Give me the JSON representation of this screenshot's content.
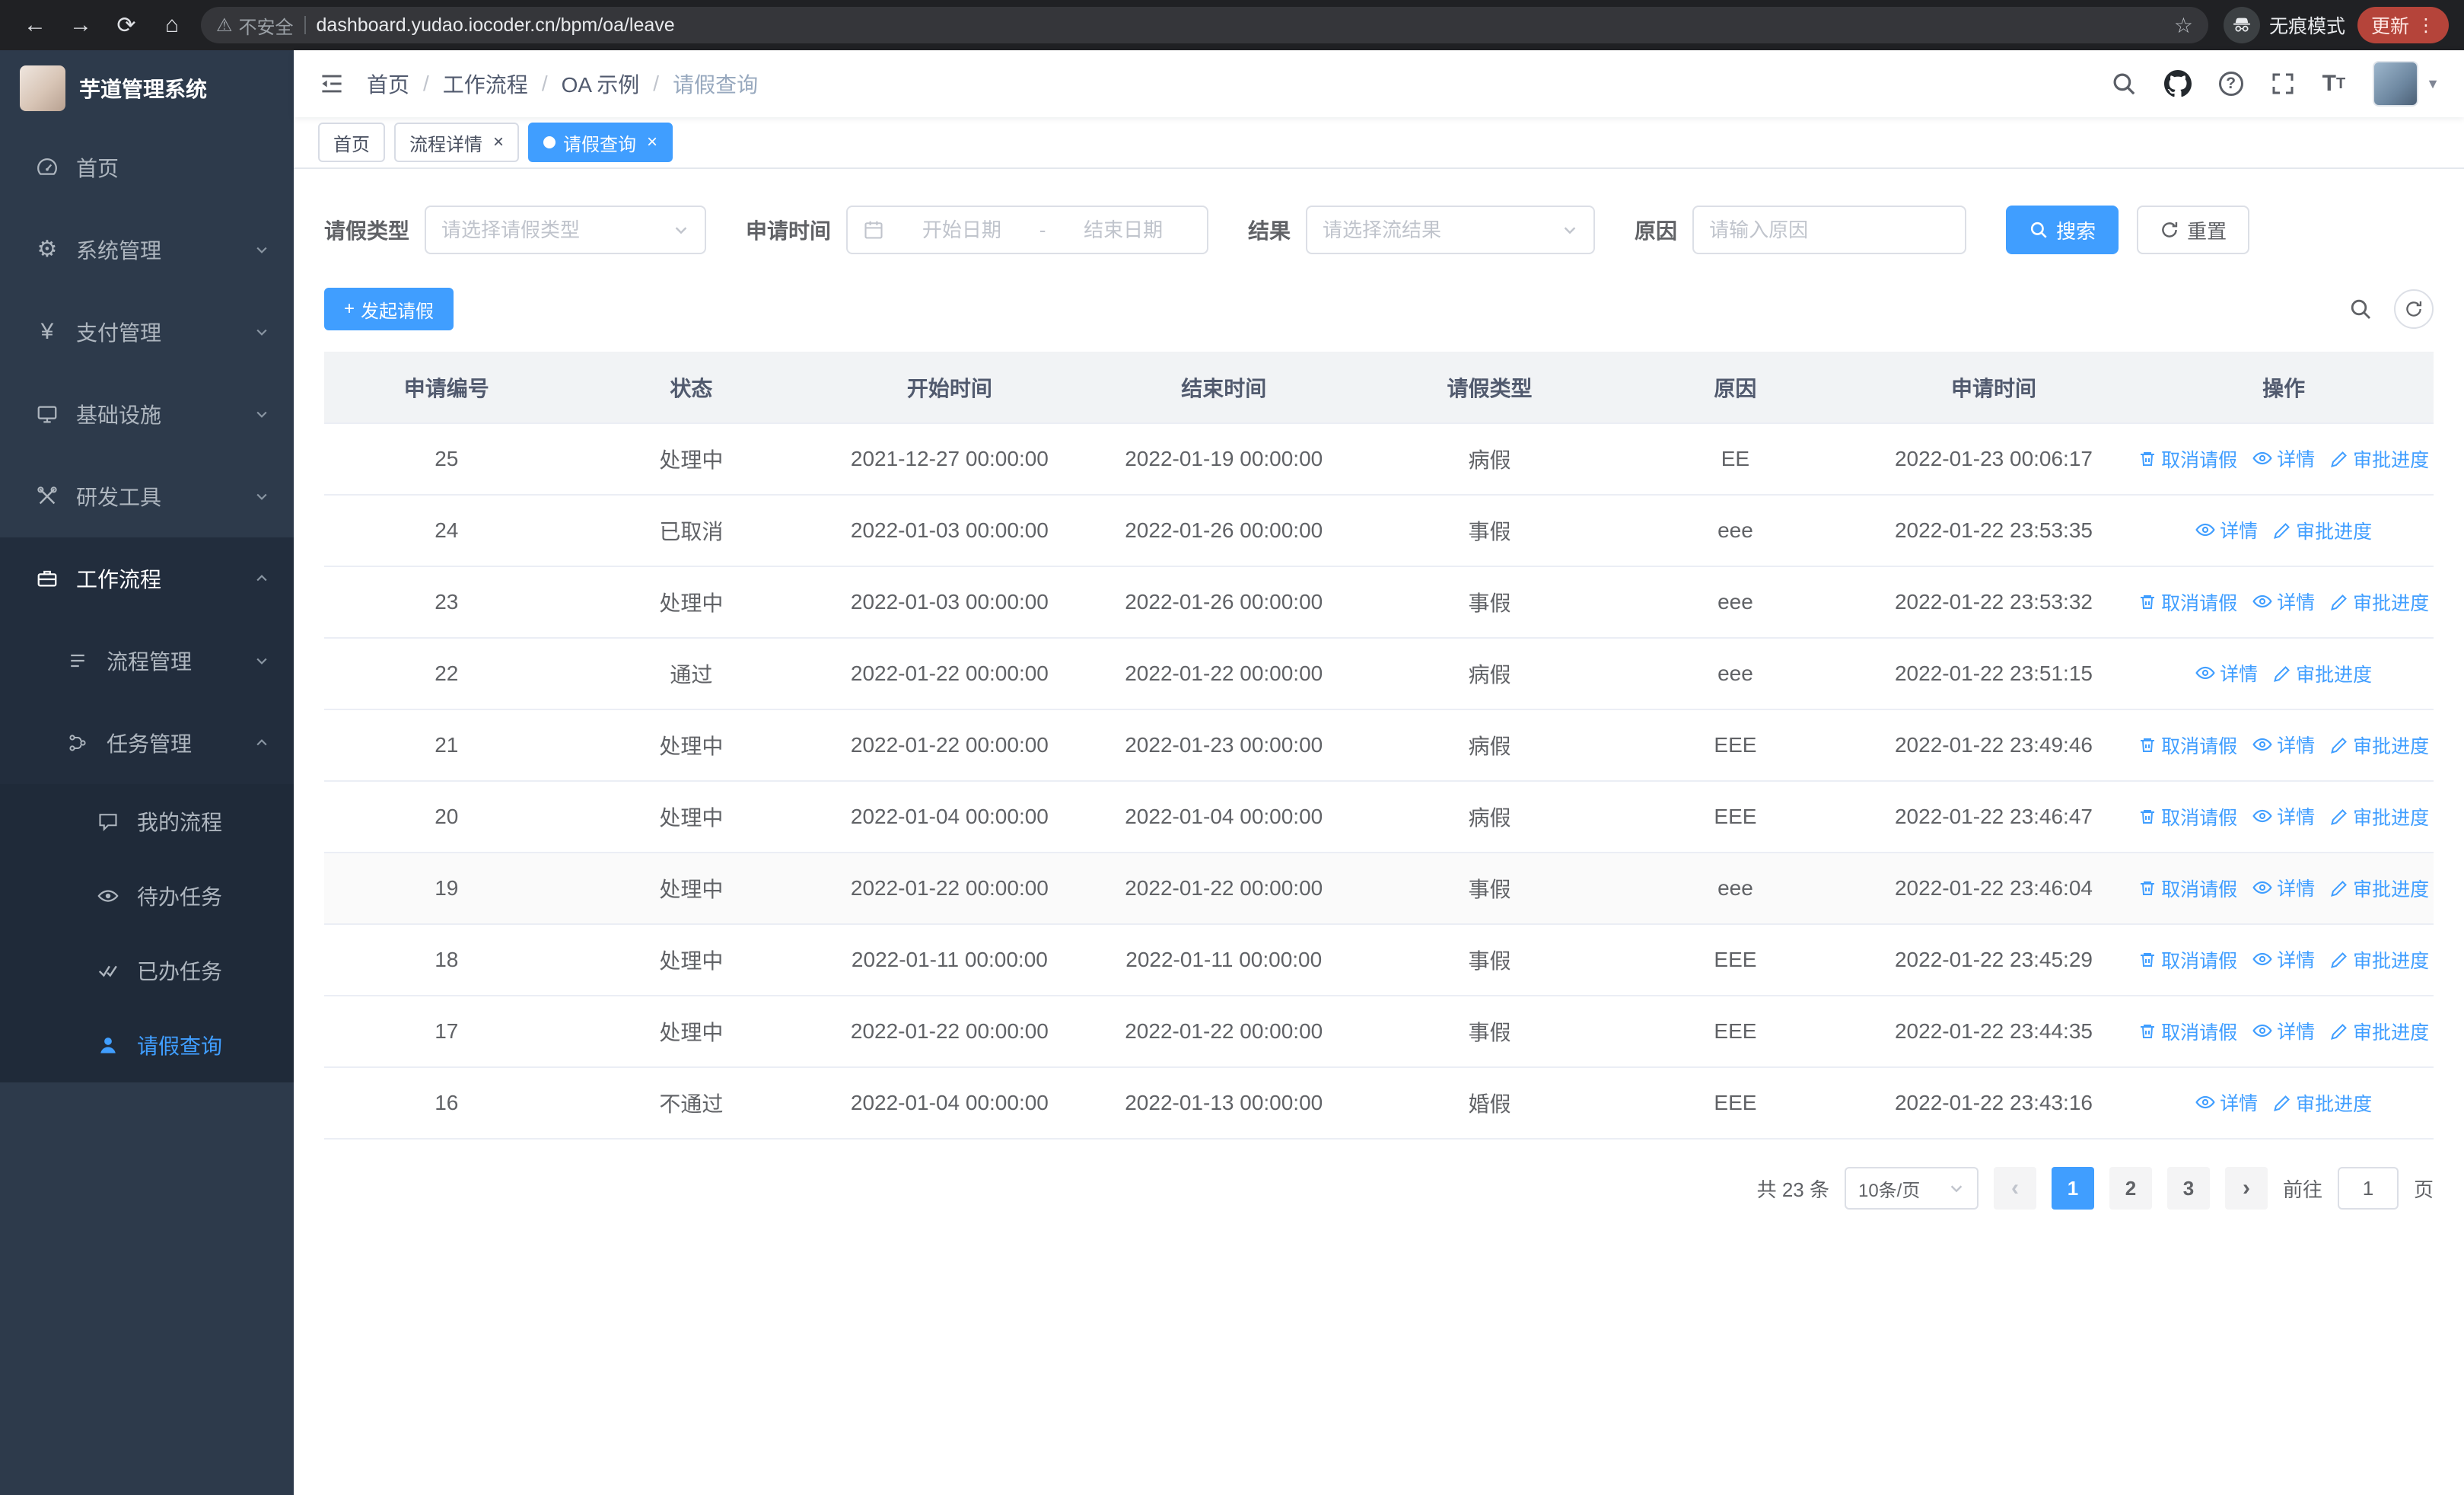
{
  "browser": {
    "security_label": "不安全",
    "url": "dashboard.yudao.iocoder.cn/bpm/oa/leave",
    "incognito_label": "无痕模式",
    "update_label": "更新"
  },
  "icons": {
    "back-icon": "←",
    "forward-icon": "→",
    "reload-icon": "⟳",
    "home-icon": "⌂",
    "warning-icon": "⚠",
    "star-icon": "☆",
    "more-icon": "⋮",
    "gear-icon": "⚙",
    "yen-icon": "¥",
    "plus-icon": "+",
    "prev-icon": "‹",
    "next-icon": "›",
    "close-icon": "×"
  },
  "sidebar": {
    "logo_title": "芋道管理系统",
    "items": [
      {
        "label": "首页"
      },
      {
        "label": "系统管理"
      },
      {
        "label": "支付管理"
      },
      {
        "label": "基础设施"
      },
      {
        "label": "研发工具"
      },
      {
        "label": "工作流程"
      },
      {
        "label": "流程管理"
      },
      {
        "label": "任务管理"
      },
      {
        "label": "我的流程"
      },
      {
        "label": "待办任务"
      },
      {
        "label": "已办任务"
      },
      {
        "label": "请假查询"
      }
    ]
  },
  "breadcrumb": {
    "items": [
      "首页",
      "工作流程",
      "OA 示例",
      "请假查询"
    ]
  },
  "tabs": [
    {
      "label": "首页"
    },
    {
      "label": "流程详情"
    },
    {
      "label": "请假查询"
    }
  ],
  "filters": {
    "leave_type_label": "请假类型",
    "leave_type_placeholder": "请选择请假类型",
    "apply_time_label": "申请时间",
    "start_date_placeholder": "开始日期",
    "date_separator": "-",
    "end_date_placeholder": "结束日期",
    "result_label": "结果",
    "result_placeholder": "请选择流结果",
    "reason_label": "原因",
    "reason_placeholder": "请输入原因",
    "search_label": "搜索",
    "reset_label": "重置"
  },
  "toolbar": {
    "create_label": "发起请假"
  },
  "table": {
    "columns": [
      "申请编号",
      "状态",
      "开始时间",
      "结束时间",
      "请假类型",
      "原因",
      "申请时间",
      "操作"
    ],
    "op_labels": {
      "cancel": "取消请假",
      "detail": "详情",
      "progress": "审批进度"
    },
    "rows": [
      {
        "id": "25",
        "status": "处理中",
        "start": "2021-12-27 00:00:00",
        "end": "2022-01-19 00:00:00",
        "type": "病假",
        "reason": "EE",
        "applied": "2022-01-23 00:06:17",
        "ops": [
          "cancel",
          "detail",
          "progress"
        ],
        "highlight": false
      },
      {
        "id": "24",
        "status": "已取消",
        "start": "2022-01-03 00:00:00",
        "end": "2022-01-26 00:00:00",
        "type": "事假",
        "reason": "eee",
        "applied": "2022-01-22 23:53:35",
        "ops": [
          "detail",
          "progress"
        ],
        "highlight": false
      },
      {
        "id": "23",
        "status": "处理中",
        "start": "2022-01-03 00:00:00",
        "end": "2022-01-26 00:00:00",
        "type": "事假",
        "reason": "eee",
        "applied": "2022-01-22 23:53:32",
        "ops": [
          "cancel",
          "detail",
          "progress"
        ],
        "highlight": false
      },
      {
        "id": "22",
        "status": "通过",
        "start": "2022-01-22 00:00:00",
        "end": "2022-01-22 00:00:00",
        "type": "病假",
        "reason": "eee",
        "applied": "2022-01-22 23:51:15",
        "ops": [
          "detail",
          "progress"
        ],
        "highlight": false
      },
      {
        "id": "21",
        "status": "处理中",
        "start": "2022-01-22 00:00:00",
        "end": "2022-01-23 00:00:00",
        "type": "病假",
        "reason": "EEE",
        "applied": "2022-01-22 23:49:46",
        "ops": [
          "cancel",
          "detail",
          "progress"
        ],
        "highlight": false
      },
      {
        "id": "20",
        "status": "处理中",
        "start": "2022-01-04 00:00:00",
        "end": "2022-01-04 00:00:00",
        "type": "病假",
        "reason": "EEE",
        "applied": "2022-01-22 23:46:47",
        "ops": [
          "cancel",
          "detail",
          "progress"
        ],
        "highlight": false
      },
      {
        "id": "19",
        "status": "处理中",
        "start": "2022-01-22 00:00:00",
        "end": "2022-01-22 00:00:00",
        "type": "事假",
        "reason": "eee",
        "applied": "2022-01-22 23:46:04",
        "ops": [
          "cancel",
          "detail",
          "progress"
        ],
        "highlight": true
      },
      {
        "id": "18",
        "status": "处理中",
        "start": "2022-01-11 00:00:00",
        "end": "2022-01-11 00:00:00",
        "type": "事假",
        "reason": "EEE",
        "applied": "2022-01-22 23:45:29",
        "ops": [
          "cancel",
          "detail",
          "progress"
        ],
        "highlight": false
      },
      {
        "id": "17",
        "status": "处理中",
        "start": "2022-01-22 00:00:00",
        "end": "2022-01-22 00:00:00",
        "type": "事假",
        "reason": "EEE",
        "applied": "2022-01-22 23:44:35",
        "ops": [
          "cancel",
          "detail",
          "progress"
        ],
        "highlight": false
      },
      {
        "id": "16",
        "status": "不通过",
        "start": "2022-01-04 00:00:00",
        "end": "2022-01-13 00:00:00",
        "type": "婚假",
        "reason": "EEE",
        "applied": "2022-01-22 23:43:16",
        "ops": [
          "detail",
          "progress"
        ],
        "highlight": false
      }
    ]
  },
  "pagination": {
    "total_label": "共 23 条",
    "page_size_label": "10条/页",
    "pages": [
      "1",
      "2",
      "3"
    ],
    "goto_label": "前往",
    "goto_value": "1",
    "page_unit_label": "页"
  },
  "colors": {
    "accent": "#409eff",
    "sidebar_bg": "#2d3a4b",
    "chrome_bg": "#202124"
  }
}
